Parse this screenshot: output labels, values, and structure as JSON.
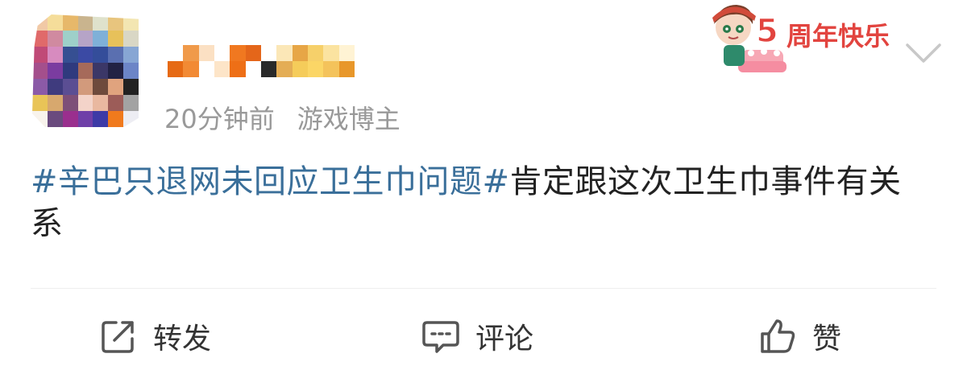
{
  "post": {
    "meta": {
      "time": "20分钟前",
      "user_tag": "游戏博主"
    },
    "badge_text": "5周年快乐",
    "hashtag": "#辛巴只退网未回应卫生巾问题#",
    "body": "肯定跟这次卫生巾事件有关系"
  },
  "actions": {
    "repost_label": "转发",
    "comment_label": "评论",
    "like_label": "赞"
  },
  "icons": {
    "repost": "share-box-icon",
    "comment": "comment-bubble-icon",
    "like": "thumbs-up-icon",
    "menu": "chevron-down-icon"
  },
  "colors": {
    "hashtag": "#3a6f9a",
    "meta_text": "#999999",
    "body_text": "#222222",
    "divider": "#eeeeee"
  }
}
